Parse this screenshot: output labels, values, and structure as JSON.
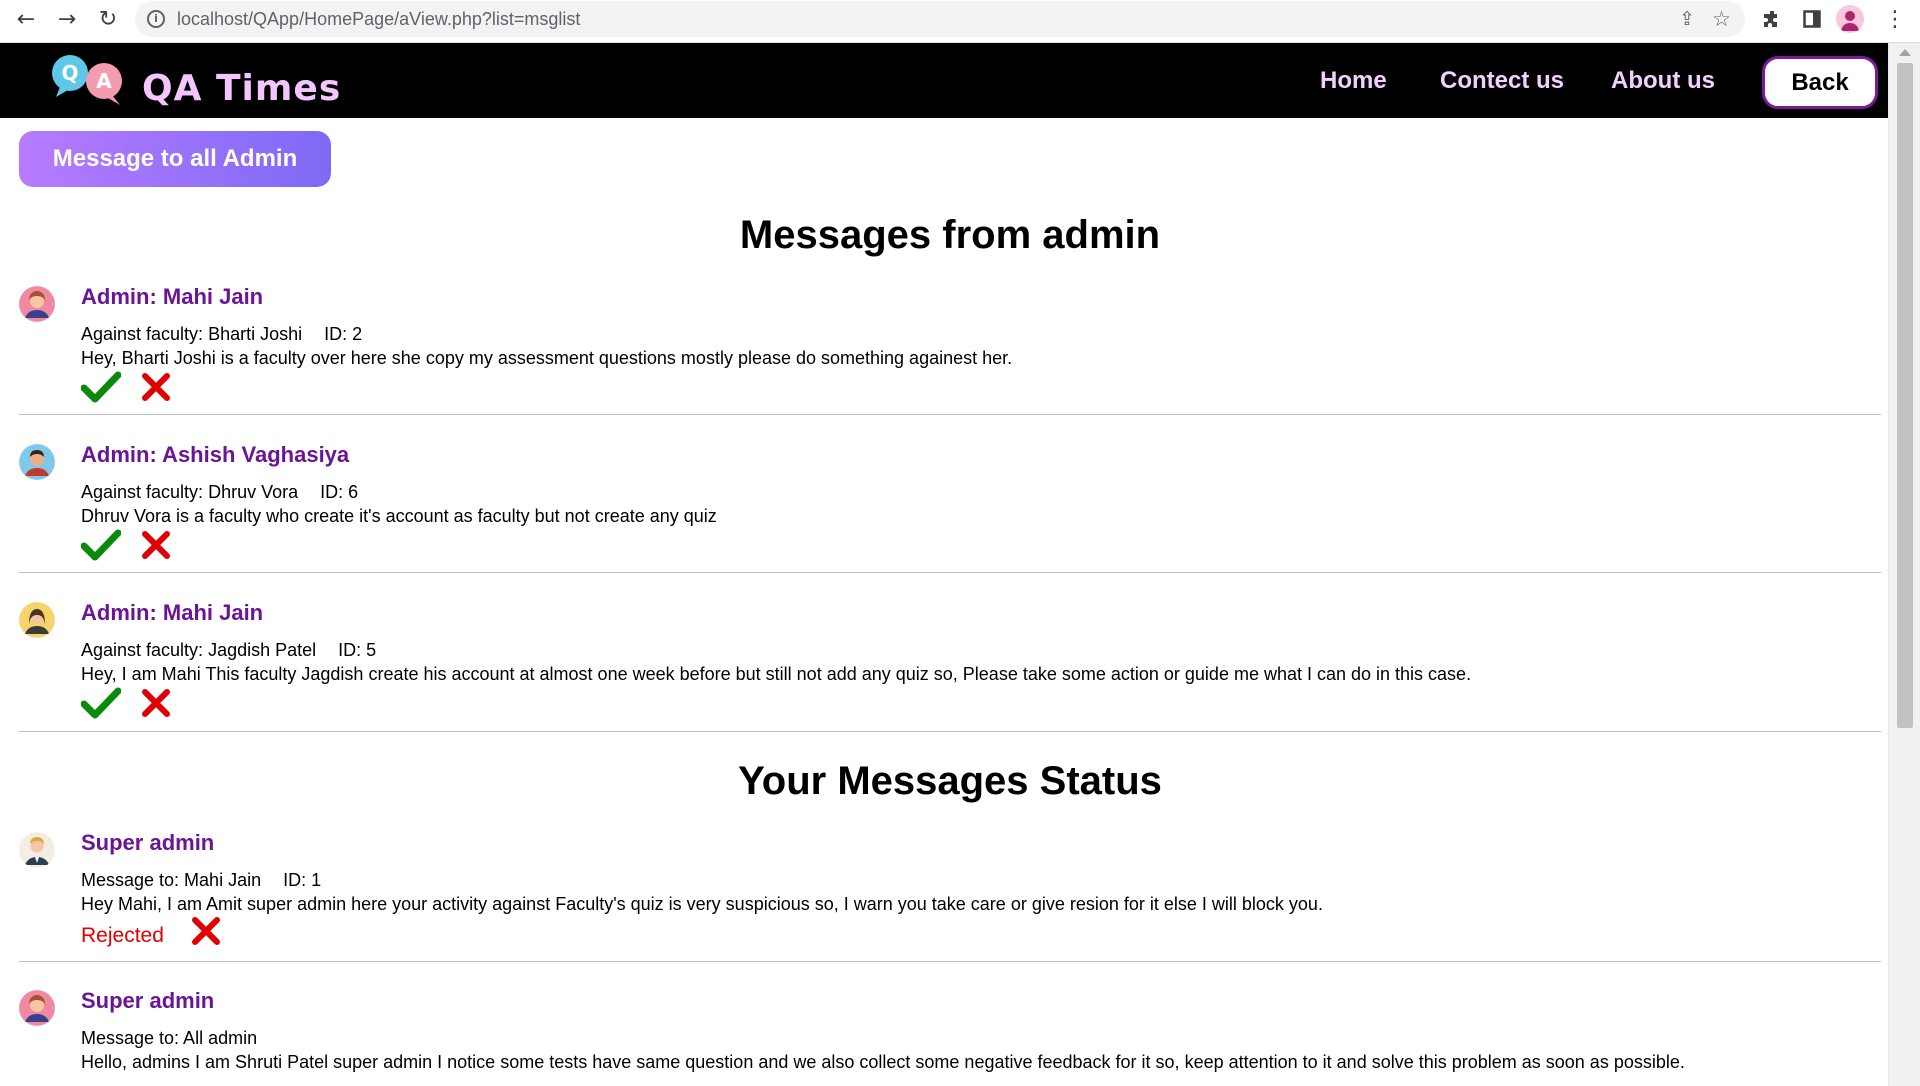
{
  "browser": {
    "url": "localhost/QApp/HomePage/aView.php?list=msglist",
    "back_icon": "arrow-left-icon",
    "forward_icon": "arrow-right-icon",
    "reload_icon": "reload-icon"
  },
  "header": {
    "logo_text": "QA Times",
    "logo_bubble_left": "Q",
    "logo_bubble_right": "A",
    "nav": {
      "home": "Home",
      "contact": "Contect us",
      "about": "About us"
    },
    "back_label": "Back"
  },
  "actions": {
    "message_all_admin": "Message to all Admin"
  },
  "admin_section": {
    "title": "Messages from admin",
    "messages": [
      {
        "sender": "Admin: Mahi Jain",
        "meta_label": "Against faculty: Bharti Joshi",
        "id_label": "ID: 2",
        "body": "Hey, Bharti Joshi is a faculty over here she copy my assessment questions mostly please do something againest her.",
        "avatar": "female-avatar-pink"
      },
      {
        "sender": "Admin: Ashish Vaghasiya",
        "meta_label": "Against faculty: Dhruv Vora",
        "id_label": "ID: 6",
        "body": "Dhruv Vora is a faculty who create it's account as faculty but not create any quiz",
        "avatar": "male-avatar-blue"
      },
      {
        "sender": "Admin: Mahi Jain",
        "meta_label": "Against faculty: Jagdish Patel",
        "id_label": "ID: 5",
        "body": "Hey, I am Mahi This faculty Jagdish create his account at almost one week before but still not add any quiz so, Please take some action or guide me what I can do in this case.",
        "avatar": "female-avatar-yellow"
      }
    ]
  },
  "status_section": {
    "title": "Your Messages Status",
    "messages": [
      {
        "sender": "Super admin",
        "meta_label": "Message to: Mahi Jain",
        "id_label": "ID: 1",
        "body": "Hey Mahi, I am Amit super admin here your activity against Faculty's quiz is very suspicious so, I warn you take care or give resion for it else I will block you.",
        "status": "Rejected",
        "avatar": "male-avatar-suit"
      },
      {
        "sender": "Super admin",
        "meta_label": "Message to: All admin",
        "id_label": "",
        "body": "Hello, admins I am Shruti Patel super admin I notice some tests have same question and we also collect some negative feedback for it so, keep attention to it and solve this problem as soon as possible.",
        "avatar": "female-avatar-pink"
      }
    ]
  },
  "colors": {
    "header_bg": "#000000",
    "nav_text": "#f3d0ff",
    "sender_purple": "#6a1595",
    "accept_green": "#0a8a0a",
    "reject_red": "#e00000",
    "button_gradient_start": "#b77bff",
    "button_gradient_end": "#7e6af5"
  }
}
